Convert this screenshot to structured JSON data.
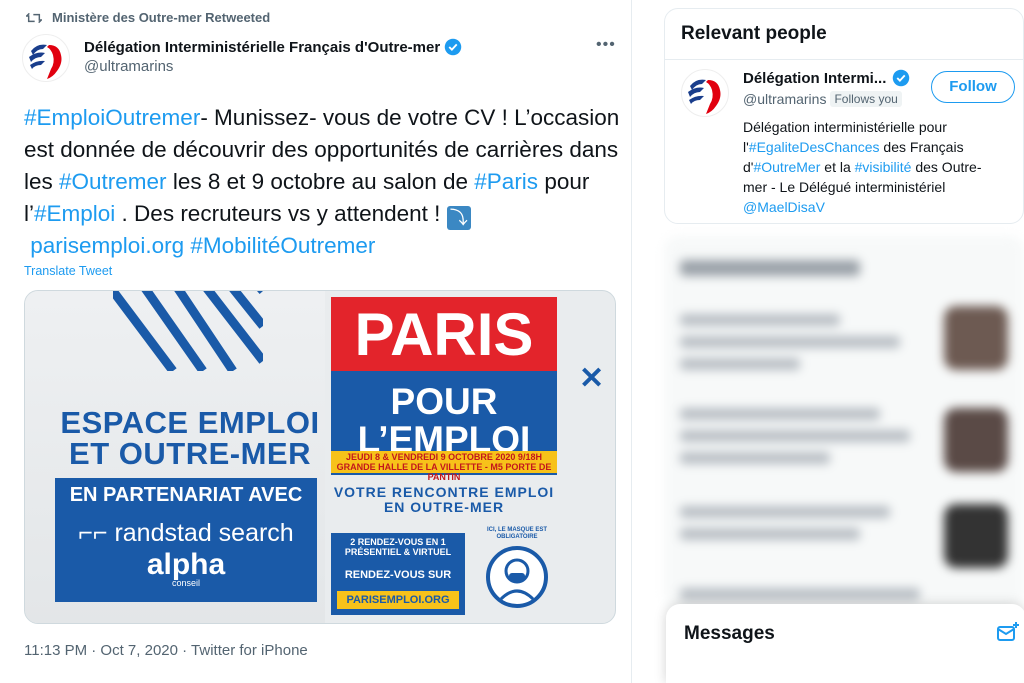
{
  "retweet": {
    "label": "Ministère des Outre-mer Retweeted"
  },
  "tweet": {
    "author_name": "Délégation Interministérielle Français d'Outre-mer",
    "author_handle": "@ultramarins",
    "more": "•••",
    "text_segments": {
      "tag_emploioutremer": "#EmploiOutremer",
      "t1": "-  Munissez- vous de votre CV ! L’occasion est donnée de découvrir des opportunités de carrières dans les ",
      "tag_outremer": "#Outremer",
      "t2": " les 8 et 9 octobre au salon de ",
      "tag_paris": "#Paris",
      "t3": " pour l’",
      "tag_emploi": "#Emploi",
      "t4": " . Des recruteurs vs y attendent ! ",
      "arrow": "⤵",
      "link": "parisemploi.org",
      "t5": " ",
      "tag_mobilite": "#MobilitéOutremer"
    },
    "translate": "Translate Tweet",
    "meta": "11:13 PM · Oct 7, 2020 · Twitter for iPhone"
  },
  "card": {
    "espace_title": "ESPACE EMPLOI ET OUTRE-MER",
    "partner_head": "EN PARTENARIAT AVEC",
    "randstad": "randstad search",
    "alpha": "alpha",
    "alpha_sub": "conseil",
    "paris": "PARIS",
    "pour_emploi": "POUR L’EMPLOI",
    "date_line1": "JEUDI 8 & VENDREDI 9 OCTOBRE 2020 9/18H",
    "date_line2": "GRANDE HALLE DE LA VILLETTE - M5 PORTE DE PANTIN",
    "rencontre": "VOTRE RENCONTRE EMPLOI EN OUTRE-MER",
    "rdv1": "2 RENDEZ-VOUS EN 1 PRÉSENTIEL & VIRTUEL",
    "rdv2": "RENDEZ-VOUS SUR",
    "rdv_url": "PARISEMPLOI.ORG",
    "mask_text": "ICI, LE MASQUE EST OBLIGATOIRE",
    "close": "✕"
  },
  "sidebar": {
    "relevant_title": "Relevant people",
    "person": {
      "name": "Délégation Intermi...",
      "handle": "@ultramarins",
      "follows_you": "Follows you",
      "follow_label": "Follow",
      "bio_segments": {
        "b1": "Délégation interministérielle pour l'",
        "tag_egalite": "#EgaliteDesChances",
        "b2": " des Français d'",
        "tag_outremer": "#OutreMer",
        "b3": " et la ",
        "tag_visibilite": "#visibilité",
        "b4": " des Outre-mer - Le Délégué interministériel ",
        "mention": "@MaelDisaV"
      }
    },
    "messages_title": "Messages"
  },
  "colors": {
    "accent": "#1d9bf0",
    "brand_blue": "#1a5aa8",
    "brand_red": "#e3242b",
    "brand_yellow": "#f7c21a"
  }
}
